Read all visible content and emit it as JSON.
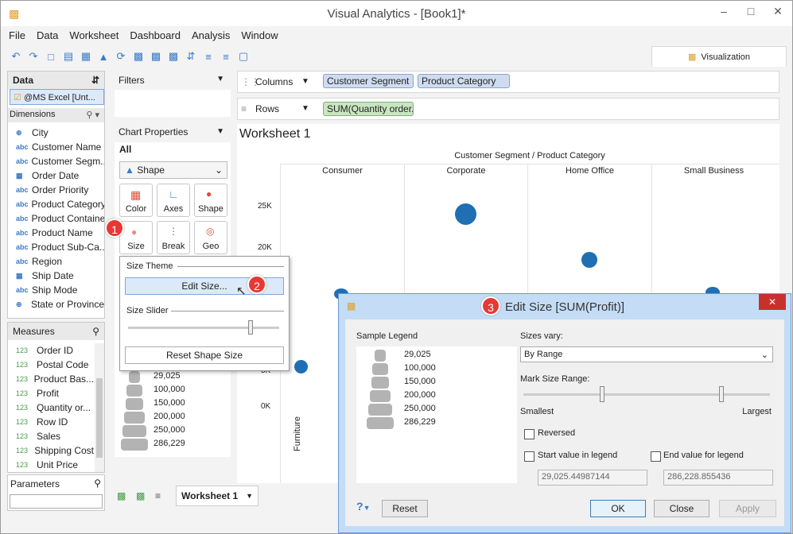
{
  "window": {
    "title": "Visual Analytics - [Book1]*",
    "min": "–",
    "max": "□",
    "close": "✕"
  },
  "menu": [
    "File",
    "Data",
    "Worksheet",
    "Dashboard",
    "Analysis",
    "Window"
  ],
  "viz_tab": "Visualization",
  "data_panel": {
    "header": "Data",
    "source": "@MS Excel [Unt...",
    "dimensions_label": "Dimensions",
    "dimensions": [
      {
        "icon": "globe",
        "name": "City"
      },
      {
        "icon": "abc",
        "name": "Customer Name"
      },
      {
        "icon": "abc",
        "name": "Customer Segm..."
      },
      {
        "icon": "date",
        "name": "Order Date"
      },
      {
        "icon": "abc",
        "name": "Order Priority"
      },
      {
        "icon": "abc",
        "name": "Product Category"
      },
      {
        "icon": "abc",
        "name": "Product Container"
      },
      {
        "icon": "abc",
        "name": "Product Name"
      },
      {
        "icon": "abc",
        "name": "Product Sub-Ca..."
      },
      {
        "icon": "abc",
        "name": "Region"
      },
      {
        "icon": "date",
        "name": "Ship Date"
      },
      {
        "icon": "abc",
        "name": "Ship Mode"
      },
      {
        "icon": "globe",
        "name": "State or Province"
      }
    ],
    "measures_label": "Measures",
    "measures": [
      "Order ID",
      "Postal Code",
      "Product Bas...",
      "Profit",
      "Quantity or...",
      "Row ID",
      "Sales",
      "Shipping Cost",
      "Unit Price"
    ],
    "measure_icon": "123",
    "abc": "abc",
    "parameters_label": "Parameters"
  },
  "filters": {
    "label": "Filters"
  },
  "chart_props": {
    "label": "Chart Properties",
    "all": "All",
    "mark": "Shape",
    "buttons": [
      "Color",
      "Axes",
      "Shape",
      "Size",
      "Break",
      "Geo"
    ]
  },
  "legend_values": [
    "29,025",
    "100,000",
    "150,000",
    "200,000",
    "250,000",
    "286,229"
  ],
  "shelves": {
    "columns": "Columns",
    "rows": "Rows",
    "col_pills": [
      "Customer Segment",
      "Product Category"
    ],
    "row_pills": [
      "SUM(Quantity order..."
    ]
  },
  "worksheet": {
    "title": "Worksheet 1",
    "header": "Customer Segment / Product Category",
    "segments": [
      "Consumer",
      "Corporate",
      "Home Office",
      "Small Business"
    ],
    "yticks": [
      "25K",
      "20K",
      "5K",
      "0K"
    ],
    "xlabel": "Furniture"
  },
  "size_popup": {
    "theme": "Size Theme",
    "edit": "Edit Size...",
    "slider": "Size Slider",
    "reset": "Reset Shape Size"
  },
  "dialog": {
    "title": "Edit Size [SUM(Profit)]",
    "sample": "Sample Legend",
    "vary_label": "Sizes vary:",
    "vary_value": "By Range",
    "range_label": "Mark Size Range:",
    "smallest": "Smallest",
    "largest": "Largest",
    "reversed": "Reversed",
    "start_label": "Start value in legend",
    "end_label": "End value for legend",
    "start_value": "29,025.44987144",
    "end_value": "286,228.855436",
    "help": "?",
    "reset": "Reset",
    "ok": "OK",
    "close": "Close",
    "apply": "Apply"
  },
  "tabs": {
    "sheet": "Worksheet 1"
  },
  "badges": [
    "1",
    "2",
    "3"
  ],
  "colors": {
    "accent": "#1f6fb2",
    "dialog_title": "#c4dcf5",
    "badge": "#e53935"
  }
}
